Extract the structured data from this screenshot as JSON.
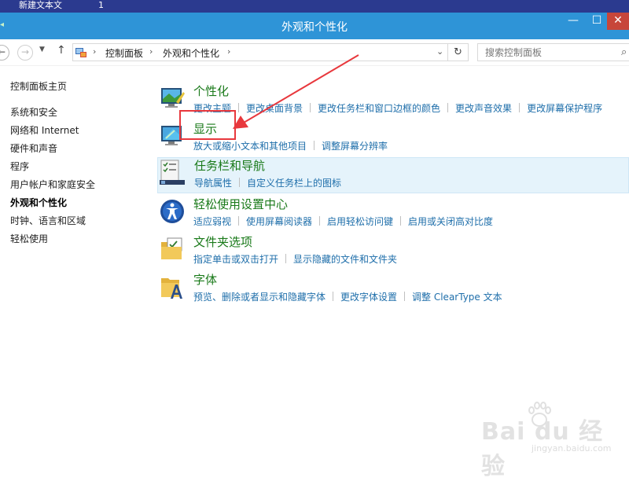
{
  "desktop": {
    "item_label": "新建文本文",
    "item_number": "1"
  },
  "window": {
    "title": "外观和个性化",
    "minimize": "—",
    "maximize": "☐",
    "close": "✕"
  },
  "nav": {
    "back": "←",
    "forward": "→",
    "recent": "▼",
    "up": "↑",
    "breadcrumb": [
      "控制面板",
      "外观和个性化"
    ],
    "breadcrumb_sep": "›",
    "address_dropdown": "⌄",
    "refresh": "↻",
    "search_placeholder": "搜索控制面板",
    "search_icon": "⌕"
  },
  "sidebar": {
    "items": [
      {
        "label": "控制面板主页",
        "active": false
      },
      {
        "label": "系统和安全",
        "active": false
      },
      {
        "label": "网络和 Internet",
        "active": false
      },
      {
        "label": "硬件和声音",
        "active": false
      },
      {
        "label": "程序",
        "active": false
      },
      {
        "label": "用户帐户和家庭安全",
        "active": false
      },
      {
        "label": "外观和个性化",
        "active": true
      },
      {
        "label": "时钟、语言和区域",
        "active": false
      },
      {
        "label": "轻松使用",
        "active": false
      }
    ]
  },
  "categories": [
    {
      "title": "个性化",
      "icon": "personalization-icon",
      "links": [
        "更改主题",
        "更改桌面背景",
        "更改任务栏和窗口边框的颜色",
        "更改声音效果",
        "更改屏幕保护程序"
      ]
    },
    {
      "title": "显示",
      "icon": "display-icon",
      "links": [
        "放大或缩小文本和其他项目",
        "调整屏幕分辨率"
      ]
    },
    {
      "title": "任务栏和导航",
      "icon": "taskbar-icon",
      "links": [
        "导航属性",
        "自定义任务栏上的图标"
      ]
    },
    {
      "title": "轻松使用设置中心",
      "icon": "ease-of-access-icon",
      "links": [
        "适应弱视",
        "使用屏幕阅读器",
        "启用轻松访问键",
        "启用或关闭高对比度"
      ]
    },
    {
      "title": "文件夹选项",
      "icon": "folder-options-icon",
      "links": [
        "指定单击或双击打开",
        "显示隐藏的文件和文件夹"
      ]
    },
    {
      "title": "字体",
      "icon": "fonts-icon",
      "links": [
        "预览、删除或者显示和隐藏字体",
        "更改字体设置",
        "调整 ClearType 文本"
      ]
    }
  ],
  "watermark": {
    "brand": "Bai du 经验",
    "site": "jingyan.baidu.com"
  },
  "colors": {
    "title_bar": "#2e94d7",
    "category_title": "#1a7a1a",
    "link": "#1e6eaa",
    "highlight": "#e5f3fb",
    "annotation": "#e8383d"
  }
}
